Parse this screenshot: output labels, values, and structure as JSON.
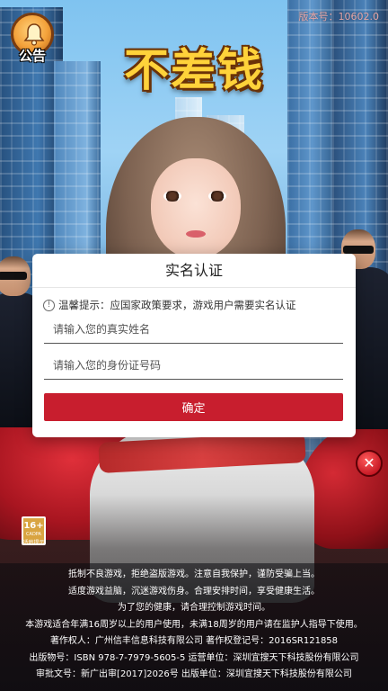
{
  "header": {
    "notice_label": "公告",
    "version": "版本号：10602.0"
  },
  "logo": {
    "text": "不差钱"
  },
  "modal": {
    "title": "实名认证",
    "tip": "温馨提示：应国家政策要求，游戏用户需要实名认证",
    "name_placeholder": "请输入您的真实姓名",
    "id_placeholder": "请输入您的身份证号码",
    "name_value": "",
    "id_value": "",
    "confirm_label": "确定"
  },
  "age_rating": {
    "label": "16+",
    "org": "CADPA",
    "caption": "适龄提示"
  },
  "footer": {
    "lines": [
      "抵制不良游戏，拒绝盗版游戏。注意自我保护，谨防受骗上当。",
      "适度游戏益脑，沉迷游戏伤身。合理安排时间，享受健康生活。",
      "为了您的健康，请合理控制游戏时间。",
      "本游戏适合年满16周岁以上的用户使用，未满18周岁的用户请在监护人指导下使用。",
      "著作权人：广州信丰信息科技有限公司 著作权登记号：2016SR121858",
      "出版物号：ISBN 978-7-7979-5605-5 运营单位：深圳宜搜天下科技股份有限公司",
      "审批文号：新广出审[2017]2026号 出版单位：深圳宜搜天下科技股份有限公司"
    ]
  },
  "colors": {
    "primary_button": "#c81e2e",
    "version_text": "#e7a6a6"
  },
  "icons": {
    "notice": "bell-icon",
    "tip": "info-icon",
    "close": "close-icon"
  }
}
